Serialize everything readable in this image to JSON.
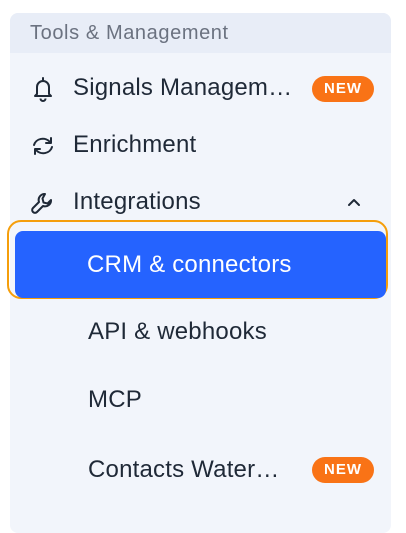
{
  "section": {
    "title": "Tools & Management"
  },
  "nav": {
    "signals": {
      "label": "Signals Managem…",
      "badge": "NEW",
      "icon": "bell-icon"
    },
    "enrichment": {
      "label": "Enrichment",
      "icon": "refresh-icon"
    },
    "integrations": {
      "label": "Integrations",
      "icon": "wrench-icon",
      "expanded": true
    },
    "sub_items": [
      {
        "label": "CRM & connectors",
        "active": true
      },
      {
        "label": "API & webhooks"
      },
      {
        "label": "MCP"
      },
      {
        "label": "Contacts Water…",
        "badge": "NEW"
      }
    ]
  },
  "colors": {
    "accent": "#2563ff",
    "badge": "#f97316",
    "focus_ring": "#f59e0b",
    "panel": "#f2f5fb"
  }
}
